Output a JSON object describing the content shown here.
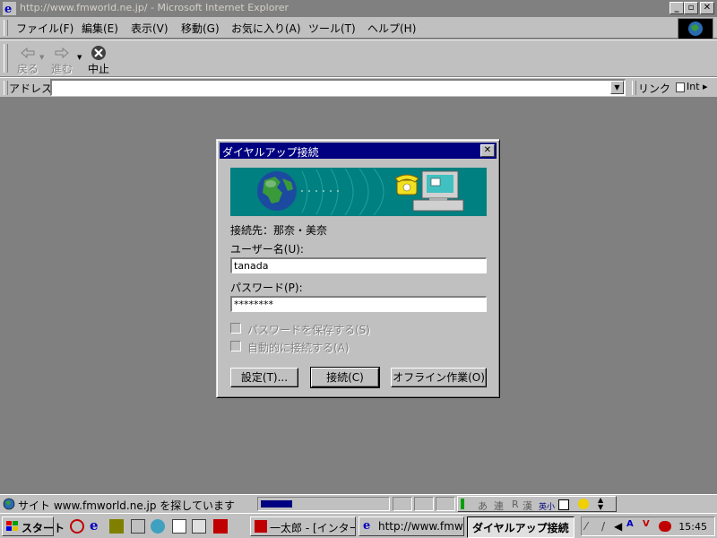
{
  "window": {
    "title": "http://www.fmworld.ne.jp/ - Microsoft Internet Explorer",
    "controls": [
      "_",
      "▫",
      "✕"
    ]
  },
  "menu": {
    "items": [
      "ファイル(F)",
      "編集(E)",
      "表示(V)",
      "移動(G)",
      "お気に入り(A)",
      "ツール(T)",
      "ヘルプ(H)"
    ]
  },
  "toolbar": {
    "back_label": "戻る",
    "forward_label": "進む",
    "stop_label": "中止"
  },
  "address": {
    "label": "アドレス",
    "value": "",
    "links_label": "リンク",
    "links_item": "Int"
  },
  "dialog": {
    "title": "ダイヤルアップ接続",
    "connect_to": "接続先：那奈・美奈",
    "username_label": "ユーザー名(U):",
    "username_value": "tanada",
    "password_label": "パスワード(P):",
    "password_value": "********",
    "save_password_label": "パスワードを保存する(S)",
    "auto_connect_label": "自動的に接続する(A)",
    "settings_button": "設定(T)...",
    "connect_button": "接続(C)",
    "offline_button": "オフライン作業(O)"
  },
  "status": {
    "text": "サイト www.fmworld.ne.jp を探しています",
    "progress_fraction": 0.25,
    "ime": [
      "あ",
      "連",
      "R",
      "漢",
      "英小"
    ]
  },
  "taskbar": {
    "start_label": "スタート",
    "tasks": [
      "一太郎 - [インター",
      "http://www.fmwo...",
      "ダイヤルアップ接続"
    ],
    "clock": "15:45"
  },
  "colors": {
    "titlebar_inactive": "#808080",
    "titlebar_active": "#000080",
    "face": "#c0c0c0",
    "desktop_bg": "#808080",
    "banner_teal": "#008080"
  }
}
